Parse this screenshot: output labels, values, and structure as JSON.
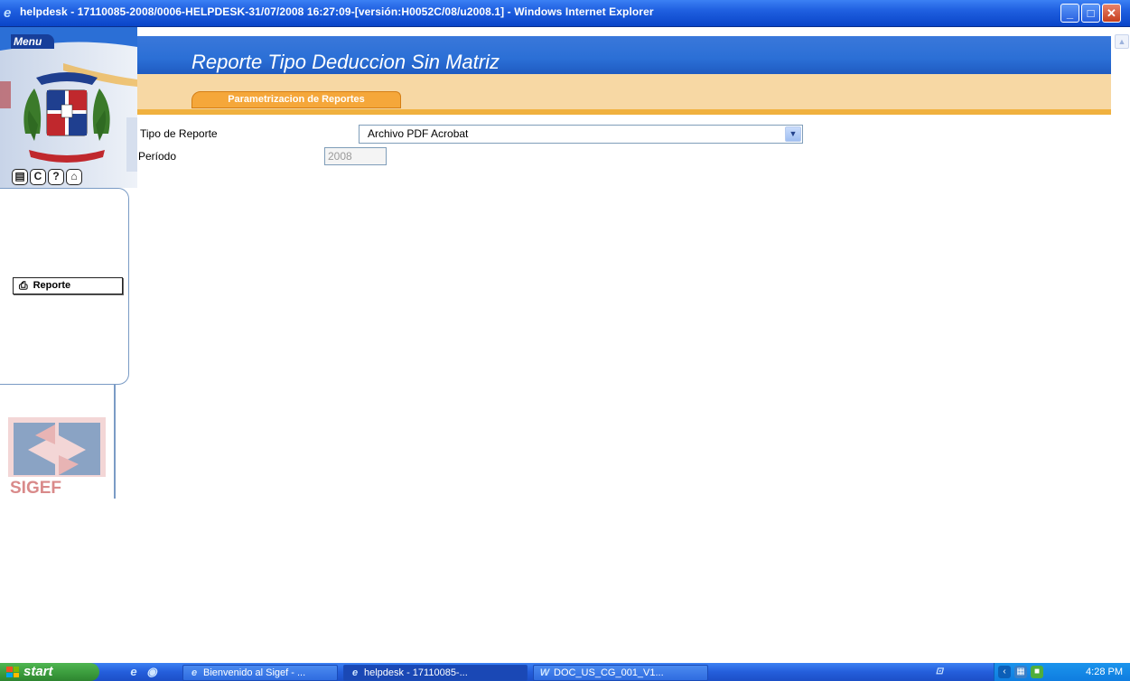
{
  "window": {
    "title": "helpdesk - 17110085-2008/0006-HELPDESK-31/07/2008 16:27:09-[versión:H0052C/08/u2008.1] - Windows Internet Explorer"
  },
  "sidebar": {
    "menu_label": "Menu",
    "reporte_button": "Reporte",
    "logo_text": "SIGEF"
  },
  "header": {
    "page_title": "Reporte Tipo Deduccion Sin Matriz",
    "tab_label": "Parametrizacion de Reportes"
  },
  "form": {
    "tipo_label": "Tipo de Reporte",
    "tipo_value": "Archivo PDF Acrobat",
    "periodo_label": "Período",
    "periodo_value": "2008"
  },
  "taskbar": {
    "start_label": "start",
    "tasks": [
      "Bienvenido al Sigef - ...",
      "helpdesk - 17110085-...",
      "DOC_US_CG_001_V1..."
    ],
    "clock": "4:28 PM"
  },
  "colors": {
    "header_blue": "#2b6fd6",
    "tab_orange": "#f5a73a",
    "band_orange_light": "#f7d8a4",
    "titlebar_blue": "#1f5fe0"
  }
}
